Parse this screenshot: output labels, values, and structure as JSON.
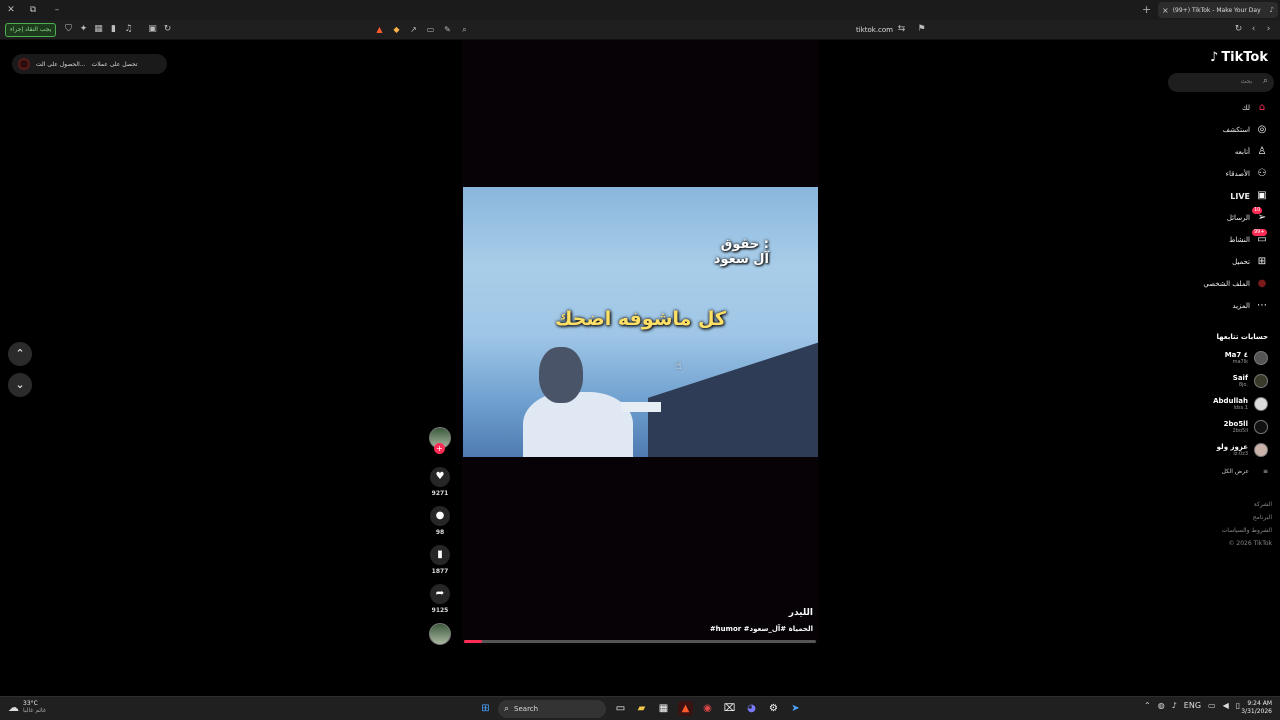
{
  "browser": {
    "tab_title": "(99+) TikTok - Make Your Day",
    "url": "tiktok.com",
    "rtl_button": "يجب النقاد إجراء",
    "new_tab": "+",
    "close": "×"
  },
  "top_pill": {
    "item1": "الحصول على الت...",
    "item2": "تحصل على عملات"
  },
  "video": {
    "overlay_line1": "حقوق :",
    "overlay_line2": "آل سعود",
    "overlay_main": "كل ماشوفه اضحك",
    "author": "الليدر",
    "caption": "#humor #الحمياة #آل_سعود",
    "progress": 0.05
  },
  "actions": {
    "likes": "9271",
    "comments": "98",
    "saves": "1877",
    "shares": "9125"
  },
  "sidebar": {
    "logo": "TikTok",
    "search_placeholder": "بحث",
    "nav": [
      {
        "label": "لك",
        "icon": "home-icon"
      },
      {
        "label": "استكشف",
        "icon": "compass-icon"
      },
      {
        "label": "أتابعه",
        "icon": "user-follow-icon"
      },
      {
        "label": "الأصدقاء",
        "icon": "friends-icon"
      },
      {
        "label": "LIVE",
        "icon": "live-icon"
      },
      {
        "label": "الرسائل",
        "icon": "send-icon",
        "badge": "10"
      },
      {
        "label": "النشاط",
        "icon": "inbox-icon",
        "badge": "99+"
      },
      {
        "label": "تحميل",
        "icon": "upload-icon"
      },
      {
        "label": "الملف الشخصي",
        "icon": "profile-icon"
      },
      {
        "label": "المزيد",
        "icon": "more-icon"
      }
    ],
    "following_title": "حسابات تتابعها",
    "following": [
      {
        "name": "Ma7 ٤",
        "handle": "ma7lk"
      },
      {
        "name": "Saif",
        "handle": "8jo."
      },
      {
        "name": "Abdullah",
        "handle": "ldss.1"
      },
      {
        "name": "2bo5ll",
        "handle": "2bo5ll"
      },
      {
        "name": "عزوز ولو",
        "handle": "lz.0z3"
      }
    ],
    "see_all": "عرض الكل",
    "footer": [
      "الشركة",
      "البرنامج",
      "الشروط والسياسات",
      "© 2026 TikTok"
    ]
  },
  "taskbar": {
    "temp": "33°C",
    "weather": "غائم غالبا",
    "search": "Search",
    "lang": "ENG",
    "time": "9:24 AM",
    "date": "3/31/2026"
  },
  "colors": {
    "accent": "#fe2c55",
    "sky": "#9fc6e6",
    "overlay_text": "#ffe066"
  }
}
